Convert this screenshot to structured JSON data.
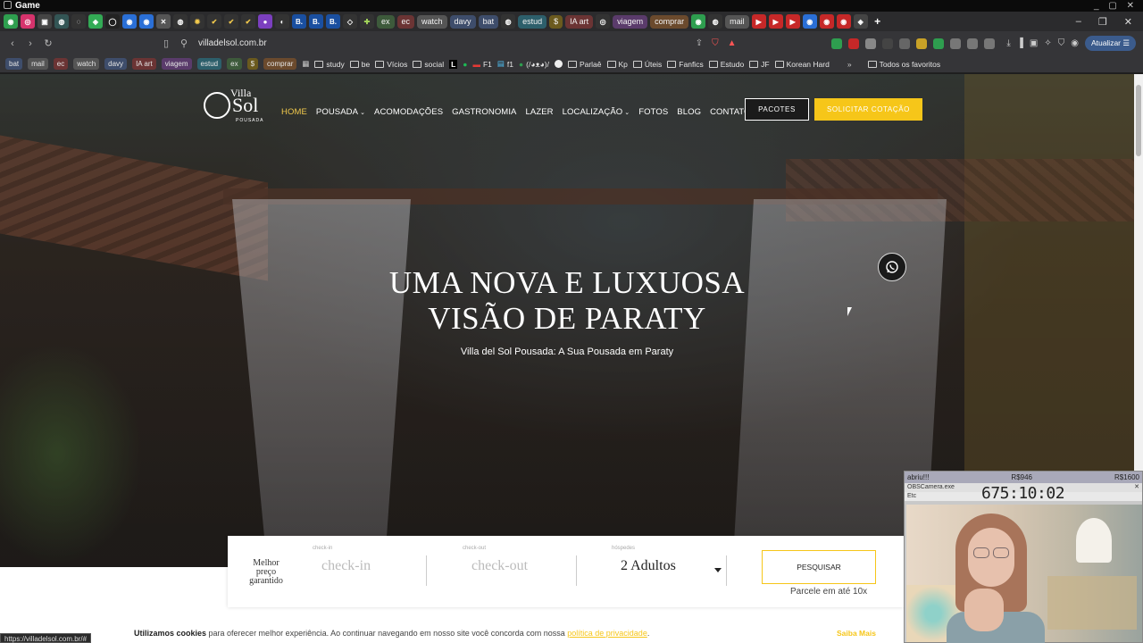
{
  "window": {
    "title": "Game"
  },
  "tabs": {
    "groups": [
      "ex",
      "ec",
      "watch",
      "davy",
      "bat",
      "estud",
      "$",
      "IA art",
      "viagem",
      "comprar",
      "mail"
    ]
  },
  "nav": {
    "url": "villadelsol.com.br",
    "update_label": "Atualizar"
  },
  "bookmarks": {
    "chips": [
      "bat",
      "mail",
      "ec",
      "watch",
      "davy",
      "IA art",
      "viagem",
      "estud",
      "ex",
      "$",
      "comprar"
    ],
    "items": [
      "study",
      "be",
      "Vícios",
      "social",
      "F1",
      "f1",
      "(/◕ᴥ◕)/",
      "Parlaê",
      "Kp",
      "Úteis",
      "Fanfics",
      "Estudo",
      "JF",
      "Korean Hard"
    ],
    "all_label": "Todos os favoritos"
  },
  "site": {
    "logo": {
      "villa": "Villa",
      "del": "del",
      "sol": "Sol",
      "pousada": "POUSADA"
    },
    "menu": [
      {
        "label": "HOME",
        "active": true
      },
      {
        "label": "POUSADA",
        "dropdown": true
      },
      {
        "label": "ACOMODAÇÕES"
      },
      {
        "label": "GASTRONOMIA"
      },
      {
        "label": "LAZER"
      },
      {
        "label": "LOCALIZAÇÃO",
        "dropdown": true
      },
      {
        "label": "FOTOS"
      },
      {
        "label": "BLOG"
      },
      {
        "label": "CONTATO"
      }
    ],
    "btn_pacotes": "PACOTES",
    "btn_cotacao": "SOLICITAR COTAÇÃO",
    "hero_title_1": "UMA NOVA E LUXUOSA",
    "hero_title_2": "VISÃO DE PARATY",
    "hero_subtitle": "Villa del Sol Pousada: A Sua Pousada em Paraty",
    "accent": "#f6c619"
  },
  "booking": {
    "best_price": "Melhor preço garantido",
    "checkin_label": "check-in",
    "checkin_placeholder": "check-in",
    "checkout_label": "check-out",
    "checkout_placeholder": "check-out",
    "guests_label": "hóspedes",
    "guests_value": "2 Adultos",
    "search_label": "PESQUISAR",
    "installments": "Parcele em até 10x"
  },
  "cookie": {
    "bold": "Utilizamos cookies",
    "text": " para oferecer melhor experiência. Ao continuar navegando em nosso site você concorda com nossa ",
    "link": "política de privacidade",
    "end": ".",
    "more": "Saiba Mais"
  },
  "statusbar": {
    "url": "https://villadelsol.com.br/#"
  },
  "overlay": {
    "label": "abriu!!!",
    "amount1": "R$946",
    "amount2": "R$1600",
    "app": "OBSCamera.exe",
    "timer": "675:10:02",
    "status": "Etc"
  }
}
